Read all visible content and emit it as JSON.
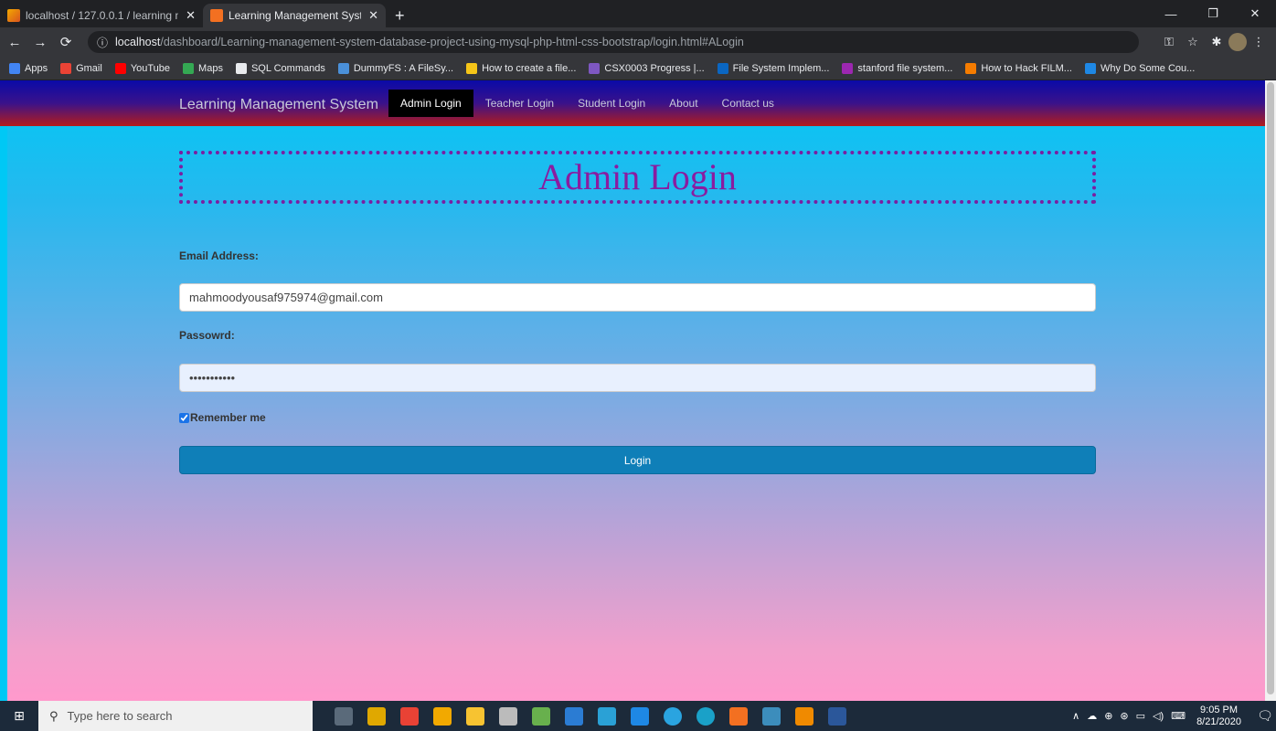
{
  "browser": {
    "tabs": [
      {
        "title": "localhost / 127.0.0.1 / learning m",
        "close": "✕"
      },
      {
        "title": "Learning Management System",
        "close": "✕"
      }
    ],
    "new_tab": "+",
    "window_controls": {
      "minimize": "—",
      "restore": "❐",
      "close": "✕"
    },
    "url": {
      "host": "localhost",
      "path": "/dashboard/Learning-management-system-database-project-using-mysql-php-html-css-bootstrap/login.html#ALogin"
    },
    "bookmarks": [
      {
        "label": "Apps",
        "color": "#4285f4"
      },
      {
        "label": "Gmail",
        "color": "#ea4335"
      },
      {
        "label": "YouTube",
        "color": "#ff0000"
      },
      {
        "label": "Maps",
        "color": "#34a853"
      },
      {
        "label": "SQL Commands",
        "color": "#e8eaed"
      },
      {
        "label": "DummyFS : A FileSy...",
        "color": "#4a90d9"
      },
      {
        "label": "How to create a file...",
        "color": "#f5c518"
      },
      {
        "label": "CSX0003 Progress |...",
        "color": "#7e57c2"
      },
      {
        "label": "File System Implem...",
        "color": "#0a66c2"
      },
      {
        "label": "stanford file system...",
        "color": "#9c27b0"
      },
      {
        "label": "How to Hack FILM...",
        "color": "#f57c00"
      },
      {
        "label": "Why Do Some Cou...",
        "color": "#1e88e5"
      }
    ]
  },
  "site": {
    "brand": "Learning Management System",
    "nav": [
      "Admin Login",
      "Teacher Login",
      "Student Login",
      "About",
      "Contact us"
    ],
    "active_nav": "Admin Login"
  },
  "form": {
    "title": "Admin Login",
    "email_label": "Email Address:",
    "email_value": "mahmoodyousaf975974@gmail.com",
    "password_label": "Passowrd:",
    "password_value": "•••••••••••",
    "remember_label": "Remember me",
    "remember_checked": true,
    "login_label": "Login"
  },
  "taskbar": {
    "search_placeholder": "Type here to search",
    "time": "9:05 PM",
    "date": "8/21/2020"
  },
  "colors": {
    "title": "#8a1ca0",
    "title_border": "#7a1fa2",
    "button": "#0f7fb8",
    "nav_active": "#000000"
  }
}
